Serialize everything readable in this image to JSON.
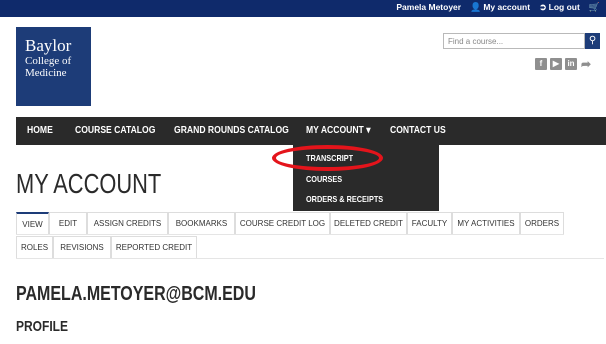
{
  "topbar": {
    "user_name": "Pamela Metoyer",
    "my_account_label": "My account",
    "logout_label": "Log out",
    "user_icon": "user-icon",
    "logout_icon": "logout-icon",
    "cart_icon": "cart-icon"
  },
  "logo": {
    "line1": "Baylor",
    "line2": "College of",
    "line3": "Medicine"
  },
  "search": {
    "placeholder": "Find a course...",
    "button_icon": "search-icon"
  },
  "social": {
    "icons": [
      "facebook-icon",
      "youtube-icon",
      "linkedin-icon",
      "share-icon"
    ],
    "f": "f",
    "yt": "▶",
    "in": "in",
    "share": "➦"
  },
  "nav": {
    "home": "HOME",
    "course_catalog": "COURSE CATALOG",
    "grand_rounds": "GRAND ROUNDS CATALOG",
    "my_account": "MY ACCOUNT",
    "my_account_caret": "▾",
    "contact_us": "CONTACT US"
  },
  "dropdown": {
    "items": [
      "TRANSCRIPT",
      "COURSES",
      "ORDERS & RECEIPTS"
    ]
  },
  "page": {
    "title": "MY ACCOUNT",
    "email": "PAMELA.METOYER@BCM.EDU",
    "profile_heading": "PROFILE"
  },
  "tabs": {
    "row1": [
      "VIEW",
      "EDIT",
      "ASSIGN CREDITS",
      "BOOKMARKS",
      "COURSE CREDIT LOG",
      "DELETED CREDIT",
      "FACULTY",
      "MY ACTIVITIES",
      "ORDERS"
    ],
    "row2": [
      "ROLES",
      "REVISIONS",
      "REPORTED CREDIT"
    ],
    "active": "VIEW"
  },
  "colors": {
    "topbar": "#0f2a6b",
    "brand_blue": "#1d3c78",
    "nav_bg": "#2a2a2a",
    "highlight": "#e4141b"
  }
}
